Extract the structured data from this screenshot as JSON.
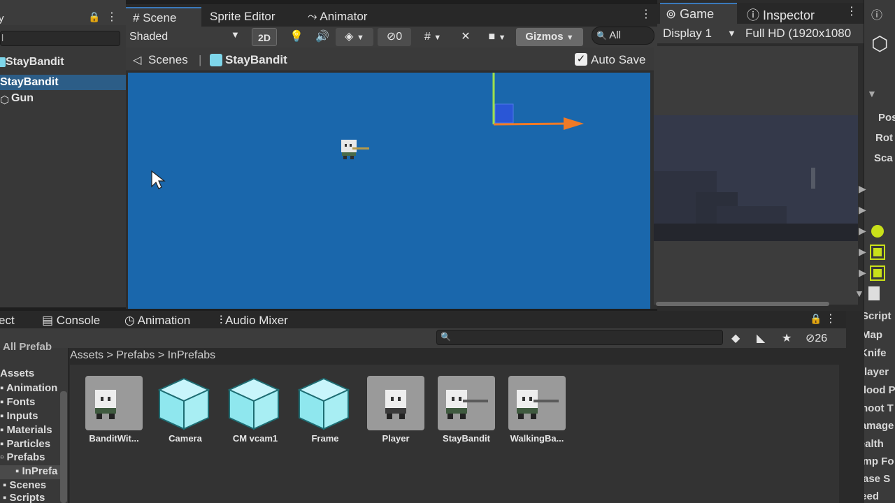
{
  "hierarchy": {
    "tab_label": "y",
    "search_value": "l",
    "root_label": "StayBandit",
    "selected_label": "StayBandit",
    "child_label": "Gun"
  },
  "scene": {
    "tabs": {
      "scene": "Scene",
      "sprite_editor": "Sprite Editor",
      "animator": "Animator"
    },
    "toolbar": {
      "shading_mode": "Shaded",
      "mode_2d": "2D",
      "hidden_count": "0",
      "gizmos": "Gizmos",
      "search_placeholder": "All"
    },
    "breadcrumb": {
      "scenes": "Scenes",
      "prefab": "StayBandit"
    },
    "auto_save_label": "Auto Save",
    "auto_save_checked": true
  },
  "game": {
    "tab_game": "Game",
    "tab_inspector": "Inspector",
    "display": "Display 1",
    "resolution": "Full HD (1920x1080"
  },
  "inspector": {
    "transform_labels": [
      "Pos",
      "Rot",
      "Sca"
    ],
    "script_fields": [
      "Script",
      "Map",
      "Knife",
      "Player",
      "Blood P",
      "Shoot T",
      "Damage",
      "Health",
      "Jump Fo",
      "Chase S",
      "Speed"
    ]
  },
  "bottom": {
    "tabs": {
      "project": "ect",
      "console": "Console",
      "animation": "Animation",
      "audio_mixer": "Audio Mixer"
    },
    "hidden_count": "26",
    "breadcrumb": "Assets  >  Prefabs  >  InPrefabs",
    "folders": [
      {
        "label": "All Prefab"
      },
      {
        "label": "Assets"
      },
      {
        "label": "Animation"
      },
      {
        "label": "Fonts"
      },
      {
        "label": "Inputs"
      },
      {
        "label": "Materials"
      },
      {
        "label": "Particles"
      },
      {
        "label": "Prefabs"
      },
      {
        "label": "InPrefa"
      },
      {
        "label": "Scenes"
      },
      {
        "label": "Scripts"
      }
    ],
    "assets": [
      {
        "label": "BanditWit...",
        "kind": "bandit-gun"
      },
      {
        "label": "Camera",
        "kind": "cube"
      },
      {
        "label": "CM vcam1",
        "kind": "cube"
      },
      {
        "label": "Frame",
        "kind": "cube"
      },
      {
        "label": "Player",
        "kind": "bandit"
      },
      {
        "label": "StayBandit",
        "kind": "bandit-gun"
      },
      {
        "label": "WalkingBa...",
        "kind": "bandit-gun"
      }
    ]
  },
  "colors": {
    "viewport_blue": "#1a67ac",
    "selection": "#2c5d87",
    "prefab_cyan": "#7ed6ea",
    "gizmo_x": "#f07a26",
    "gizmo_y": "#9fe04c"
  }
}
